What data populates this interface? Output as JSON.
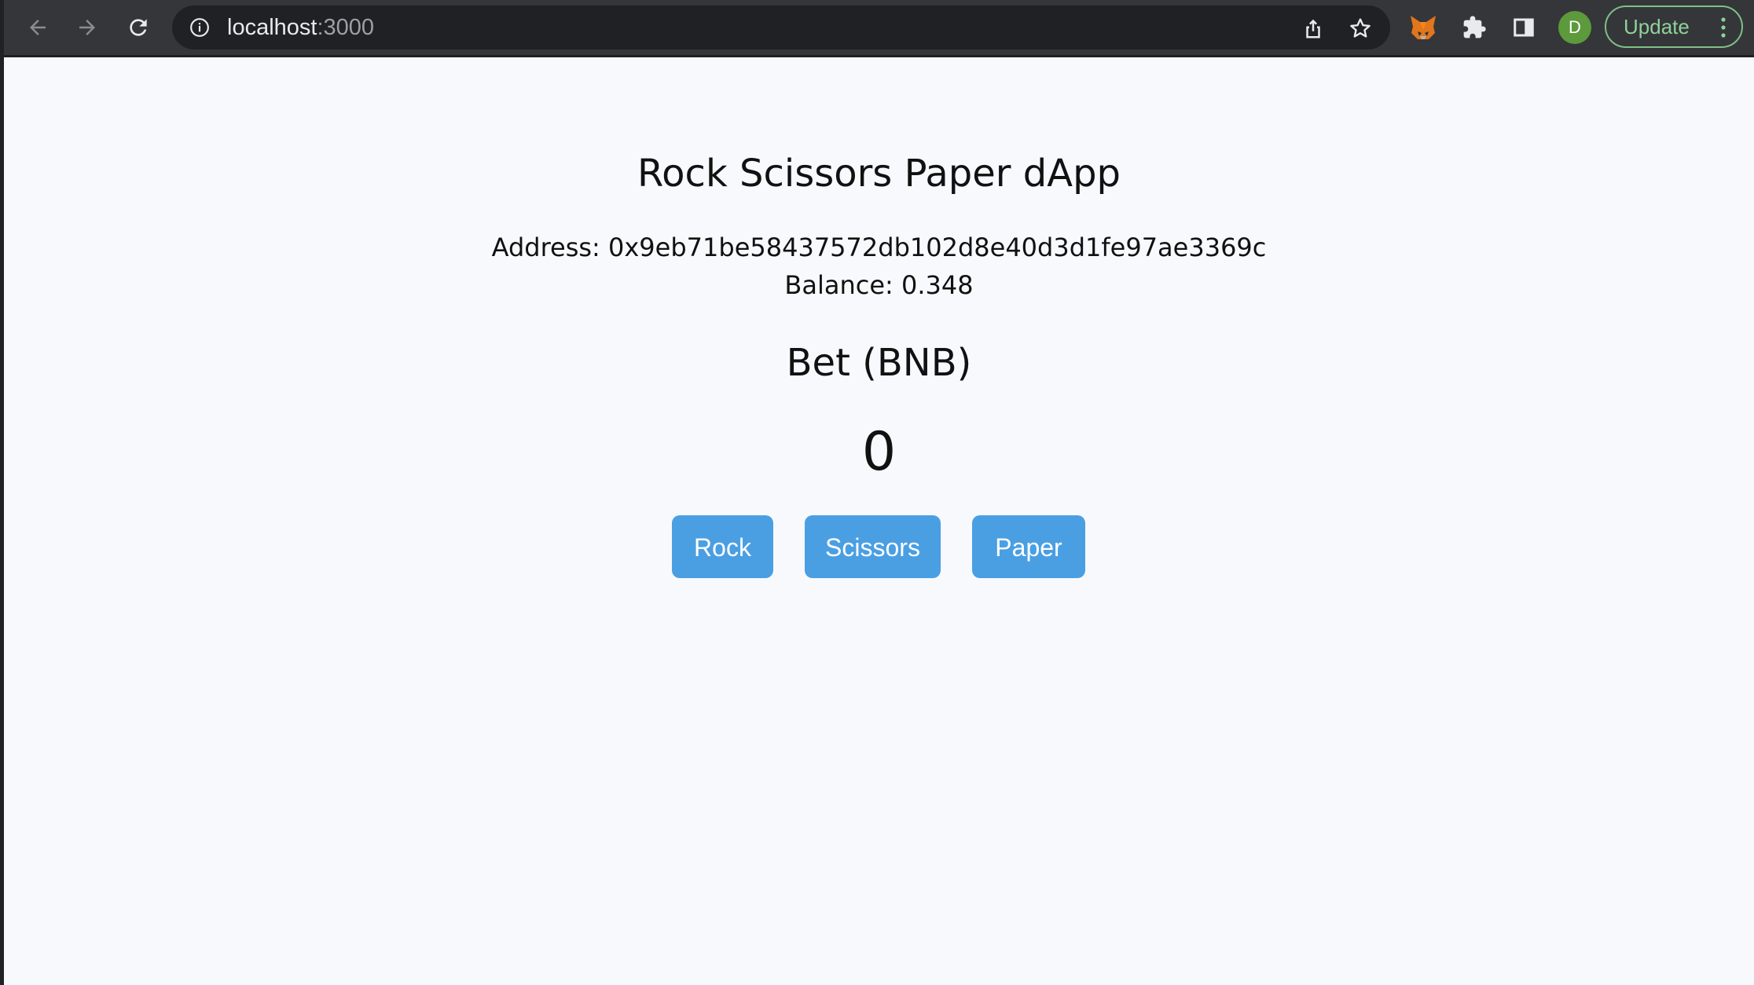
{
  "browser": {
    "url_host": "localhost",
    "url_port": ":3000",
    "avatar_letter": "D",
    "update_label": "Update",
    "icons": {
      "back": "arrow-left-icon",
      "forward": "arrow-right-icon",
      "reload": "reload-icon",
      "info": "info-icon",
      "share": "share-icon",
      "bookmark": "star-icon",
      "metamask": "fox-icon",
      "extensions": "puzzle-icon",
      "side_panel": "side-panel-icon",
      "menu": "vertical-dots-icon"
    }
  },
  "page": {
    "title": "Rock Scissors Paper dApp",
    "address": "Address: 0x9eb71be58437572db102d8e40d3d1fe97ae3369c",
    "balance": "Balance: 0.348",
    "bet_label": "Bet (BNB)",
    "bet_value": "0",
    "buttons": {
      "rock": "Rock",
      "scissors": "Scissors",
      "paper": "Paper"
    }
  },
  "colors": {
    "toolbar": "#35363a",
    "omnibox": "#202124",
    "page_background": "#f8f9fc",
    "button": "#4a9fe3",
    "update_border": "#7fbf86",
    "avatar": "#5c9a3c"
  }
}
